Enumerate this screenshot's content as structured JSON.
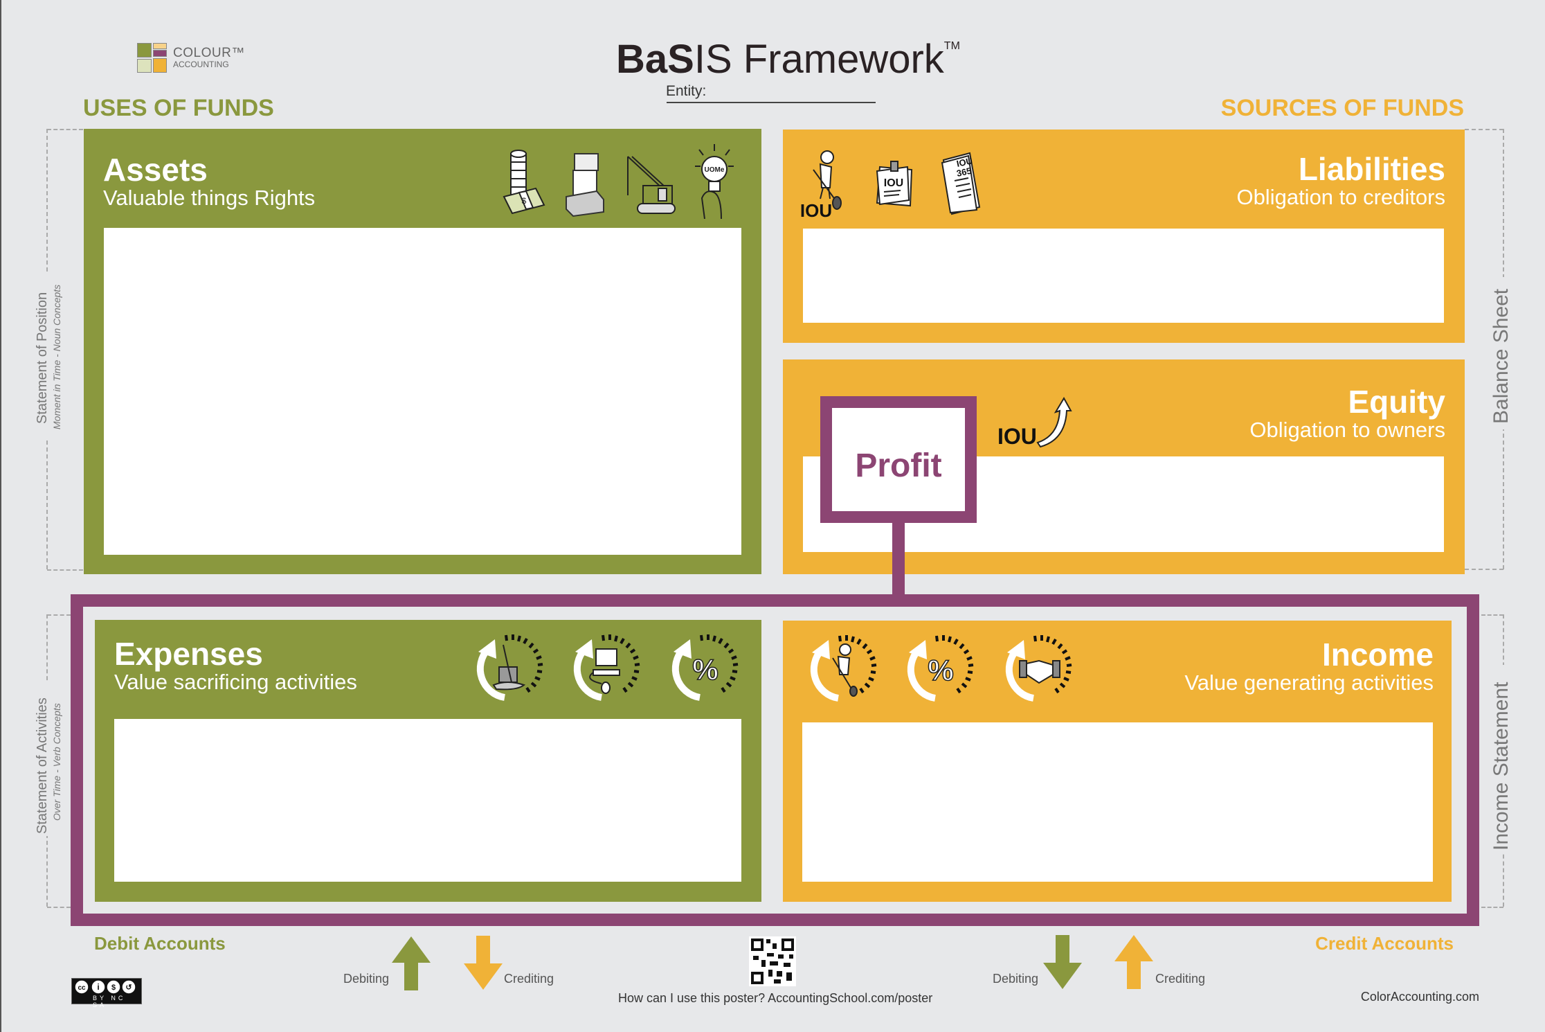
{
  "logo": {
    "line1": "COLOUR™",
    "line2": "ACCOUNTING"
  },
  "title": {
    "bold1": "Ba",
    "bold2": "S",
    "light1": "a",
    "light": "IS  Framework",
    "tm": "TM"
  },
  "entity": {
    "label": "Entity:",
    "value": ""
  },
  "headings": {
    "uses": "USES OF FUNDS",
    "sources": "SOURCES OF FUNDS"
  },
  "side_labels": {
    "position": {
      "main": "Statement of Position",
      "sub": "Moment in Time - Noun Concepts"
    },
    "activities": {
      "main": "Statement of Activities",
      "sub": "Over Time - Verb Concepts"
    },
    "balance_sheet": "Balance Sheet",
    "income_statement": "Income Statement"
  },
  "boxes": {
    "assets": {
      "title": "Assets",
      "subtitle": "Valuable things   Rights",
      "icons": [
        "coins-cash-icon",
        "boxes-inventory-icon",
        "crane-equipment-icon",
        "lightbulb-uome-icon"
      ],
      "icon_text": "UOMe"
    },
    "liabilities": {
      "title": "Liabilities",
      "subtitle": "Obligation to creditors",
      "icons": [
        "worker-iou-icon",
        "iou-note-icon",
        "iou-365-document-icon"
      ],
      "iou": "IOU",
      "iou365": "IOU 365"
    },
    "equity": {
      "title": "Equity",
      "subtitle": "Obligation to owners",
      "iou": "IOU",
      "icons": [
        "iou-arrow-up-icon"
      ]
    },
    "profit": {
      "title": "Profit"
    },
    "expenses": {
      "title": "Expenses",
      "subtitle": "Value sacrificing activities",
      "icons": [
        "cycle-mop-bucket-icon",
        "cycle-computer-icon",
        "cycle-percent-icon"
      ]
    },
    "income": {
      "title": "Income",
      "subtitle": "Value generating activities",
      "icons": [
        "cycle-worker-icon",
        "cycle-percent-icon",
        "cycle-handshake-icon"
      ]
    }
  },
  "footer": {
    "debit_accounts": "Debit Accounts",
    "credit_accounts": "Credit Accounts",
    "left_debiting": "Debiting",
    "left_crediting": "Crediting",
    "right_debiting": "Debiting",
    "right_crediting": "Crediting",
    "poster_link": "How can I use this poster? AccountingSchool.com/poster",
    "site": "ColorAccounting.com",
    "license": "BY NC SA"
  },
  "colors": {
    "green": "#8a983e",
    "orange": "#f0b237",
    "purple": "#8c4573",
    "background": "#e7e8ea"
  }
}
